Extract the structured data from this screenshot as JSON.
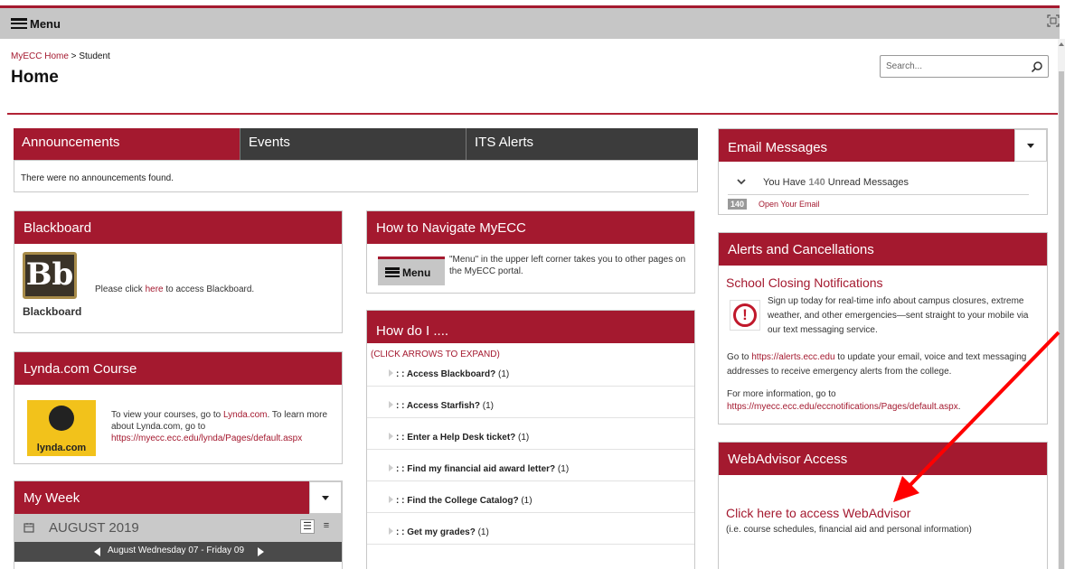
{
  "menu": {
    "label": "Menu"
  },
  "breadcrumb": {
    "home": "MyECC Home",
    "separator": " > ",
    "current": "Student"
  },
  "page": {
    "title": "Home"
  },
  "search": {
    "placeholder": "Search..."
  },
  "tabs": [
    {
      "label": "Announcements"
    },
    {
      "label": "Events"
    },
    {
      "label": "ITS Alerts"
    }
  ],
  "announcements": {
    "empty_text": "There were no announcements found."
  },
  "blackboard": {
    "title": "Blackboard",
    "logo_text": "Bb",
    "logo_name": "Blackboard",
    "text_before": "Please click ",
    "link": "here",
    "text_after": " to access Blackboard."
  },
  "navigate": {
    "title": "How to Navigate MyECC",
    "menu_label": "Menu",
    "text": "\"Menu\" in the upper left corner takes you to other pages on the MyECC portal."
  },
  "howdo": {
    "title": "How do I ....",
    "hint": "(CLICK ARROWS TO EXPAND)",
    "items": [
      {
        "label": ": : Access Blackboard?",
        "count": " (1)"
      },
      {
        "label": ": : Access Starfish?",
        "count": " (1)"
      },
      {
        "label": ": : Enter a Help Desk ticket?",
        "count": " (1)"
      },
      {
        "label": ": : Find my financial aid award letter?",
        "count": " (1)"
      },
      {
        "label": ": : Find the College Catalog?",
        "count": " (1)"
      },
      {
        "label": ": : Get my grades?",
        "count": " (1)"
      }
    ]
  },
  "lynda": {
    "title": "Lynda.com Course",
    "logo_text": "lynda.com",
    "text1": "To view your courses, go to ",
    "link1": "Lynda.com",
    "text2": ".  To learn more about Lynda.com, go to",
    "link2": "https://myecc.ecc.edu/lynda/Pages/default.aspx"
  },
  "myweek": {
    "title": "My Week",
    "month": "AUGUST 2019",
    "range": "August Wednesday 07 - Friday 09"
  },
  "email": {
    "title": "Email Messages",
    "summary_pre": "You Have ",
    "count": "140",
    "summary_post": " Unread Messages",
    "badge": "140",
    "link": "Open Your Email"
  },
  "alerts": {
    "title": "Alerts and Cancellations",
    "subtitle": "School Closing Notifications",
    "desc": "Sign up today for real-time info about campus closures, extreme weather, and other emergencies—sent straight to your mobile via our text messaging service.",
    "goto_pre": "Go to ",
    "goto_link": "https://alerts.ecc.edu",
    "goto_post": " to update your email, voice and text messaging addresses to receive emergency alerts from the college.",
    "more_pre": "For more information, go to",
    "more_link": "https://myecc.ecc.edu/eccnotifications/Pages/default.aspx",
    "more_post": "."
  },
  "webadvisor": {
    "title": "WebAdvisor Access",
    "link": "Click here to access WebAdvisor",
    "note": "(i.e. course schedules, financial aid and personal information)"
  },
  "colors": {
    "brand_red": "#a4192f",
    "dark_tab": "#3c3c3c",
    "arrow_red": "#ff0000"
  }
}
